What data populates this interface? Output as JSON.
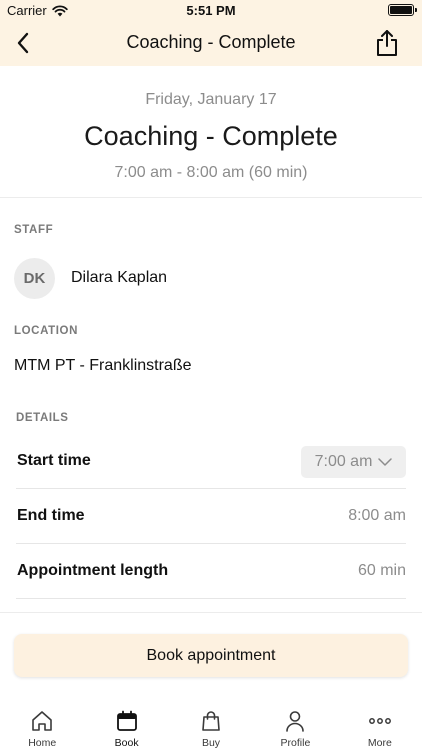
{
  "status_bar": {
    "carrier": "Carrier",
    "time": "5:51 PM"
  },
  "nav": {
    "title": "Coaching - Complete"
  },
  "header": {
    "date": "Friday, January 17",
    "title": "Coaching - Complete",
    "time_range": "7:00 am - 8:00 am (60 min)"
  },
  "staff": {
    "section_label": "STAFF",
    "initials": "DK",
    "name": "Dilara Kaplan"
  },
  "location": {
    "section_label": "LOCATION",
    "name": "MTM PT - Franklinstraße"
  },
  "details": {
    "section_label": "DETAILS",
    "start_time": {
      "label": "Start time",
      "value": "7:00 am"
    },
    "end_time": {
      "label": "End time",
      "value": "8:00 am"
    },
    "length": {
      "label": "Appointment length",
      "value": "60 min"
    }
  },
  "actions": {
    "book_label": "Book appointment"
  },
  "tabs": [
    {
      "label": "Home",
      "icon": "home-icon"
    },
    {
      "label": "Book",
      "icon": "calendar-icon",
      "active": true
    },
    {
      "label": "Buy",
      "icon": "shopping-bag-icon"
    },
    {
      "label": "Profile",
      "icon": "person-icon"
    },
    {
      "label": "More",
      "icon": "more-icon"
    }
  ],
  "colors": {
    "header_bg": "#fdf3e3",
    "button_bg": "#fdf1e0",
    "muted_text": "#8c8c8c"
  }
}
